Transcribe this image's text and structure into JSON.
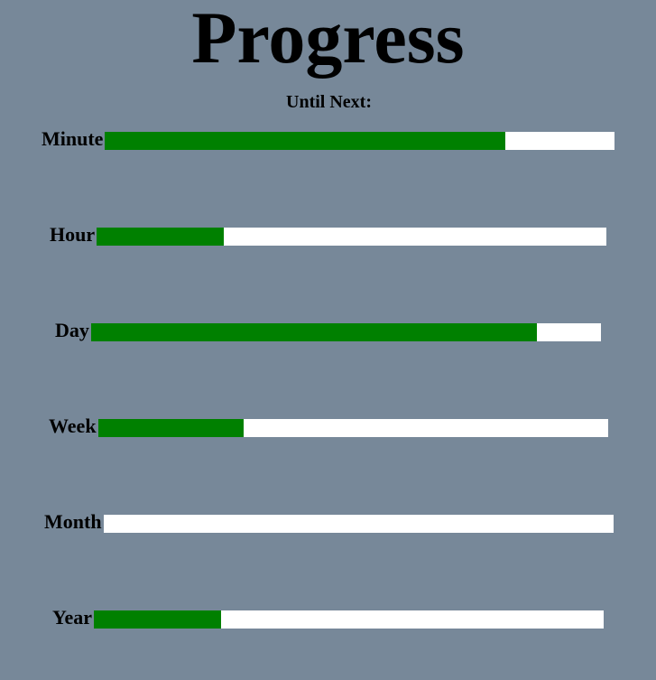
{
  "title": "Progress",
  "subtitle": "Until Next:",
  "colors": {
    "background": "#778899",
    "fill": "#008000",
    "track": "#ffffff"
  },
  "bars": [
    {
      "label": "Minute",
      "progress": 0.785
    },
    {
      "label": "Hour",
      "progress": 0.25
    },
    {
      "label": "Day",
      "progress": 0.875
    },
    {
      "label": "Week",
      "progress": 0.285
    },
    {
      "label": "Month",
      "progress": 0.0
    },
    {
      "label": "Year",
      "progress": 0.25
    }
  ]
}
